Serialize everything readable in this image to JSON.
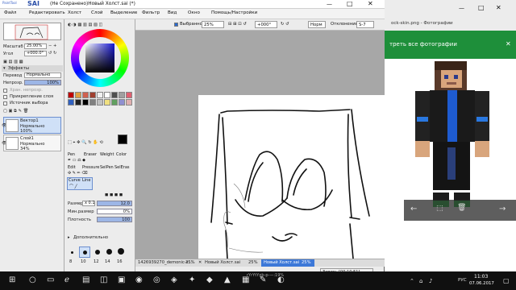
{
  "app": {
    "logo_text": "SAI",
    "logo_sub": "PaintTool",
    "title": "(Не Сохранено)Новый Холст.sai (*)",
    "controls": {
      "minimize": "—",
      "maximize": "□",
      "close": "✕"
    }
  },
  "menu": [
    "Файл",
    "Редактировать",
    "Холст",
    "Слой",
    "Выделение",
    "Фильтр",
    "Вид",
    "Окно",
    "Помощь/Настройки"
  ],
  "toolbar": {
    "selection_label": "Выбранное",
    "zoom_value": "25%",
    "angle_value": "+000°",
    "blend_value": "Норм",
    "stabilizer_label": "Отклонение",
    "stabilizer_value": "S-7"
  },
  "navigator": {
    "zoom_label": "Масштаб",
    "zoom_value": "25.00%",
    "angle_label": "Угол",
    "angle_value": "+000.0°"
  },
  "effects": {
    "header": "Эффекты",
    "mode_label": "Перевод",
    "mode_value": "Нормально",
    "opacity_label": "Непрозр.",
    "opacity_value": "100%",
    "preserve_opacity_label": "Хран. непрозр.",
    "clip_label": "Прикрепление слоя",
    "selection_source_label": "Источник выбора"
  },
  "layers": [
    {
      "name": "Вектор1",
      "mode": "Нормально",
      "opacity": "100%"
    },
    {
      "name": "Слой1",
      "mode": "Нормально",
      "opacity": "34%"
    }
  ],
  "tools": {
    "row1": [
      "Pen",
      "Eraser",
      "Weight",
      "Color"
    ],
    "row2": [
      "Edit",
      "Pressure",
      "SelPen",
      "SelEras"
    ],
    "row3": [
      "Curve",
      "Line"
    ]
  },
  "brush": {
    "size_label": "Размер",
    "size_mult": "x 0.1",
    "size_value": "12.0",
    "min_size_label": "Мин.размер",
    "min_size_value": "0%",
    "density_label": "Плотность",
    "density_value": "100",
    "advanced_label": "Дополнительно",
    "sizes": [
      "8",
      "10",
      "12",
      "14",
      "16"
    ]
  },
  "doc_tabs": [
    {
      "name": "1426939270_demonic-s...",
      "zoom": "25%"
    },
    {
      "name": "Новый Холст.sai",
      "zoom": "25%"
    },
    {
      "name": "Новый Холст.sai",
      "zoom": "25%"
    }
  ],
  "photo_viewer": {
    "file_label": "ock-skin.png - Фотографии",
    "banner": "треть все фотографии",
    "prev_arrow": "←",
    "next_arrow": "→"
  },
  "recording": "Запись [00:10:51]",
  "taskbar": {
    "clock_time": "11:03",
    "clock_date": "07.06.2017",
    "language": "РУС",
    "tray_text": "rYrYtYgb-p-—:19%"
  },
  "colors": {
    "green_banner": "#1e8f3a",
    "taskbar": "#101010",
    "canvas_bg": "#a7a7a7"
  },
  "swatches": [
    "#c00000",
    "#e0a040",
    "#d06050",
    "#a04030",
    "#f0f0f0",
    "#ffffff",
    "#505050",
    "#a0a0a0",
    "#e06070",
    "#3060c0",
    "#202020",
    "#000000",
    "#808080",
    "#c0c0c0",
    "#f0e080",
    "#60a060",
    "#9090d0",
    "#e0b0b0"
  ]
}
